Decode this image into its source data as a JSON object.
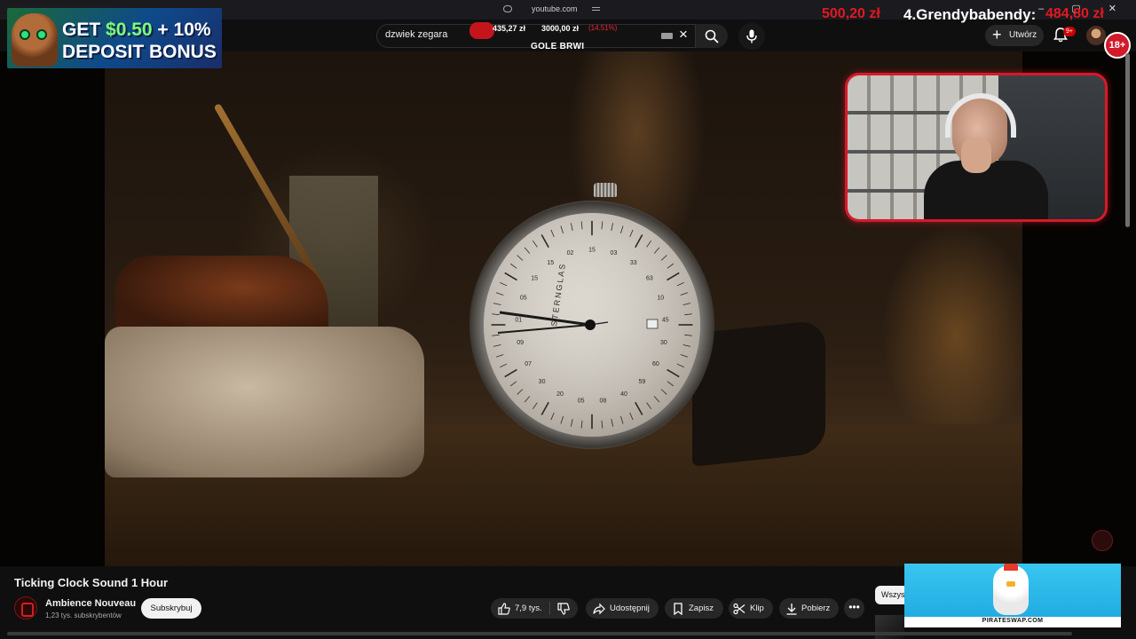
{
  "browser": {
    "url": "youtube.com",
    "window_controls": "– ▢ ✕"
  },
  "search": {
    "value": "dzwiek zegara",
    "clear_symbol": "×"
  },
  "header": {
    "create_label": "Utwórz",
    "create_symbol": "+",
    "notifications_badge": "9+"
  },
  "overlay": {
    "promo": {
      "line1_prefix": "GET ",
      "line1_highlight": "$0.50",
      "line1_suffix": " + 10%",
      "line2": "DEPOSIT BONUS"
    },
    "ticker": {
      "value_a": "435,27 zł",
      "value_b": "3000,00 zł",
      "value_c": "(14,51%)"
    },
    "caption": "GOLE BRWI",
    "leaderboard": {
      "amount_left": "500,20 zł",
      "entry_name": "4.Grendybabendy:",
      "entry_amount": "484,80 zł"
    },
    "age_badge": "18+"
  },
  "video": {
    "title": "Ticking Clock Sound 1 Hour",
    "channel_name": "Ambience Nouveau",
    "subscribers": "1,23 tys. subskrybentów",
    "subscribe_label": "Subskrybuj"
  },
  "actions": {
    "like_count": "7,9 tys.",
    "share_label": "Udostępnij",
    "save_label": "Zapisz",
    "clip_label": "Klip",
    "download_label": "Pobierz",
    "more_symbol": "•••"
  },
  "sidebar": {
    "chip_all": "Wszystko"
  },
  "ad": {
    "text": "PIRATESWAP.COM"
  },
  "watch_dial": {
    "brand": "STERNGLAS",
    "numerals": [
      "15",
      "03",
      "33",
      "63",
      "10",
      "45",
      "30",
      "60",
      "59",
      "40",
      "08",
      "05",
      "20",
      "30",
      "07",
      "09",
      "01",
      "05",
      "15",
      "15",
      "02"
    ]
  },
  "colors": {
    "accent_red": "#e21822",
    "facecam_border": "#d7192a",
    "background": "#0f0f0f"
  }
}
